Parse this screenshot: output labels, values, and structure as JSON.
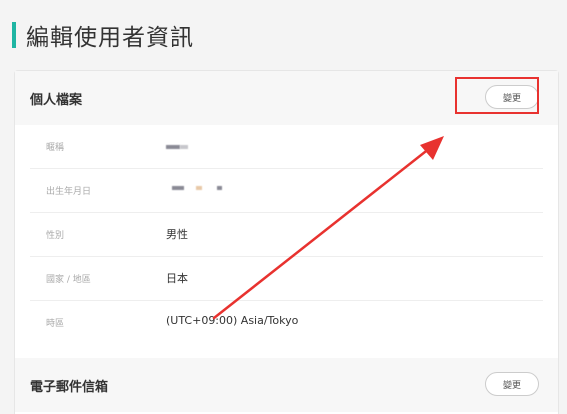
{
  "page": {
    "title": "編輯使用者資訊",
    "accent_color": "#1fb5a3"
  },
  "profile_section": {
    "title": "個人檔案",
    "change_label": "變更",
    "rows": [
      {
        "label": "暱稱",
        "value": "",
        "value_state": "redacted"
      },
      {
        "label": "出生年月日",
        "value": "",
        "value_state": "redacted"
      },
      {
        "label": "性別",
        "value": "男性"
      },
      {
        "label": "國家 / 地區",
        "value": "日本"
      },
      {
        "label": "時區",
        "value": "(UTC+09:00) Asia/Tokyo"
      }
    ]
  },
  "email_section": {
    "title": "電子郵件信箱",
    "change_label": "變更"
  },
  "annotation": {
    "highlight_color": "#e8322f",
    "arrow_color": "#e8322f"
  }
}
